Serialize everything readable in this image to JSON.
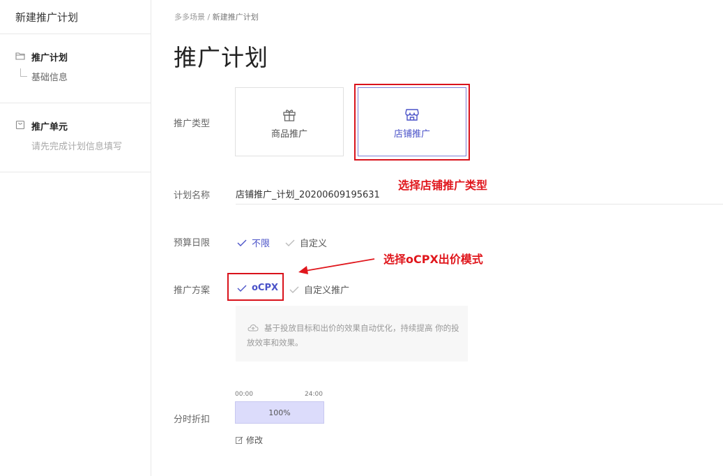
{
  "sidebar": {
    "title": "新建推广计划",
    "plan": {
      "label": "推广计划",
      "sub": "基础信息"
    },
    "unit": {
      "label": "推广单元",
      "sub": "请先完成计划信息填写"
    }
  },
  "breadcrumb": {
    "root": "多多场景",
    "separator": " / ",
    "current": "新建推广计划"
  },
  "page_title": "推广计划",
  "form": {
    "type": {
      "label": "推广类型",
      "options": [
        {
          "label": "商品推广",
          "icon": "gift-icon",
          "selected": false
        },
        {
          "label": "店铺推广",
          "icon": "store-icon",
          "selected": true
        }
      ]
    },
    "name": {
      "label": "计划名称",
      "value": "店铺推广_计划_20200609195631"
    },
    "budget": {
      "label": "预算日限",
      "options": [
        "不限",
        "自定义"
      ],
      "selected": "不限"
    },
    "scheme": {
      "label": "推广方案",
      "options": [
        "oCPX",
        "自定义推广"
      ],
      "selected": "oCPX",
      "description": "基于投放目标和出价的效果自动优化，持续提高 你的投放效率和效果。"
    },
    "schedule": {
      "label": "分时折扣",
      "start": "00:00",
      "end": "24:00",
      "value": "100%",
      "edit_label": "修改"
    }
  },
  "annotations": {
    "store_type": "选择店铺推广类型",
    "ocpx": "选择oCPX出价模式"
  },
  "colors": {
    "accent": "#4a52c8",
    "annotation": "#e0161c",
    "bar": "#dcdcfb"
  }
}
